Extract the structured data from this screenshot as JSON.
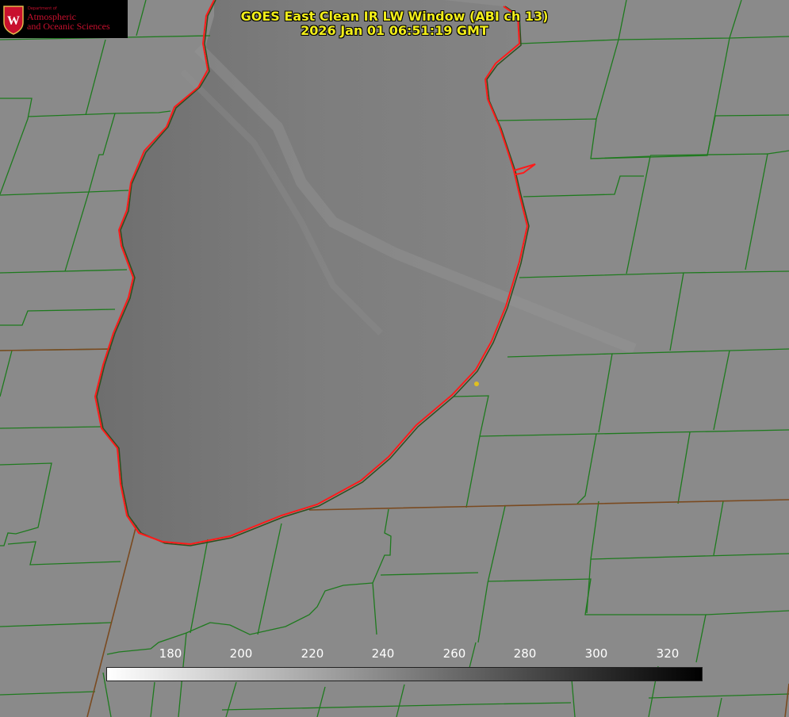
{
  "title": {
    "line1": "GOES East Clean IR LW Window (ABI ch 13)",
    "line2": "2026 Jan 01 06:51:19 GMT"
  },
  "logo": {
    "small_text": "Department of",
    "line1": "Atmospheric",
    "line2": "and Oceanic Sciences",
    "seal_letter": "W",
    "brand_color": "#c8102e"
  },
  "colorbar": {
    "ticks": [
      "180",
      "200",
      "220",
      "240",
      "260",
      "280",
      "300",
      "320"
    ],
    "gradient_start": "#ffffff",
    "gradient_end": "#000000"
  },
  "map": {
    "background_color": "#8a8a8a",
    "lake_color": "#7c7c7c",
    "county_line_color": "#1e7a1e",
    "coastline_color": "#ff1a1a",
    "marker_color": "#e0c020"
  }
}
